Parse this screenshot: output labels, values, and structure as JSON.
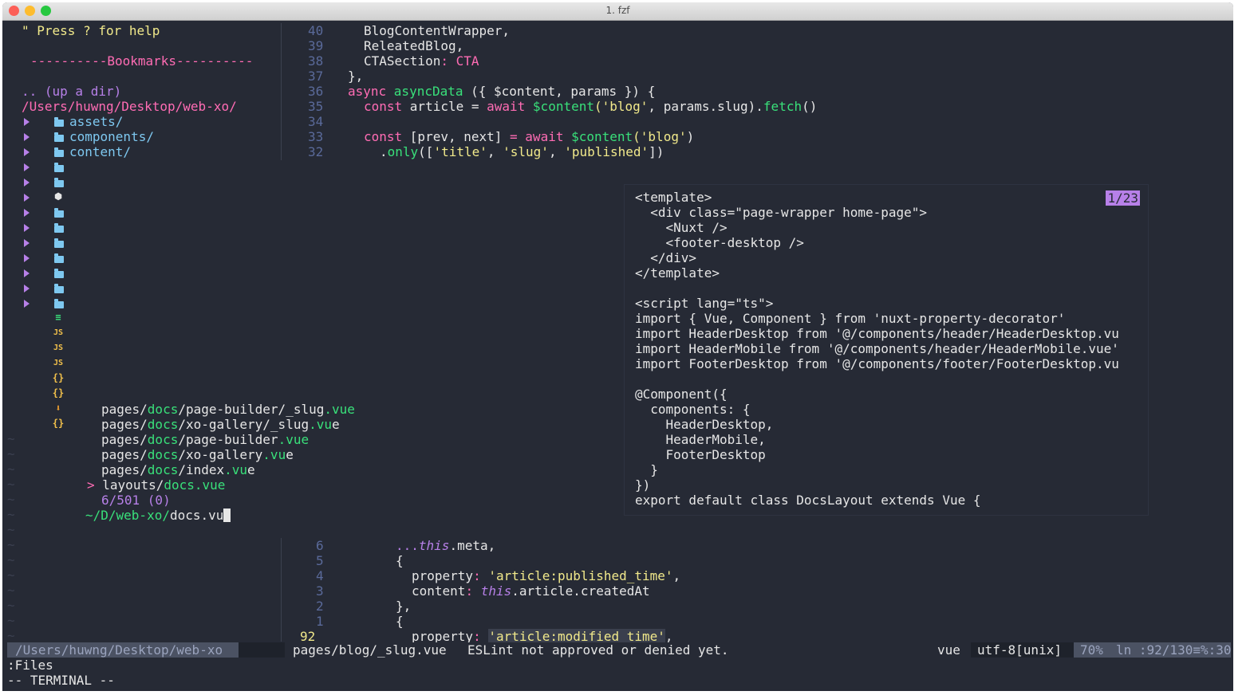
{
  "window": {
    "title": "1. fzf"
  },
  "colors": {
    "background": "#262a35",
    "pink": "#ff6cb4",
    "green": "#39e07a",
    "yellow": "#f1e98b",
    "purple": "#b780e8",
    "cyan": "#7ec8f0"
  },
  "nerdtree": {
    "help": "\" Press ? for help",
    "bookmarks": "----------Bookmarks----------",
    "up_dir": ".. (up a dir)",
    "root": "/Users/huwng/Desktop/web-xo/",
    "folders": [
      "assets/",
      "components/",
      "content/"
    ]
  },
  "editor_top": {
    "lines": [
      {
        "num": "40",
        "text": "BlogContentWrapper,"
      },
      {
        "num": "39",
        "text": "ReleatedBlog,"
      },
      {
        "num": "38",
        "text_key": "CTASection",
        "text_rest": ": CTA"
      },
      {
        "num": "37",
        "text": "},"
      },
      {
        "num": "36",
        "a": "async ",
        "b": "asyncData",
        "c": " ({ $content, params }) {"
      },
      {
        "num": "35",
        "a": "const ",
        "b": "article = ",
        "c": "await ",
        "d": "$content",
        "e": "('blog'",
        "f": ", params.slug).",
        "g": "fetch",
        "h": "()"
      },
      {
        "num": "34",
        "text": ""
      },
      {
        "num": "33",
        "a": "const ",
        "b": "[prev, next] ",
        "c": "= await ",
        "d": "$content",
        "e": "('blog'",
        "f": ")"
      },
      {
        "num": "32",
        "a": ".",
        "b": "only",
        "c": "([",
        "d": "'title'",
        "e": ", ",
        "f": "'slug'",
        "g": ", ",
        "h": "'published'",
        "i": "])"
      }
    ]
  },
  "fzf": {
    "results": [
      {
        "pre": "pages/",
        "dir": "docs",
        "mid": "/page-builder/_slug",
        "ext": ".vue",
        "last": ""
      },
      {
        "pre": "pages/",
        "dir": "docs",
        "mid": "/xo-gallery/_slug",
        "ext": ".vu",
        "last": "e"
      },
      {
        "pre": "pages/",
        "dir": "docs",
        "mid": "/page-builder",
        "ext": ".vue",
        "last": ""
      },
      {
        "pre": "pages/",
        "dir": "docs",
        "mid": "/xo-gallery",
        "ext": ".vu",
        "last": "e"
      },
      {
        "pre": "pages/",
        "dir": "docs",
        "mid": "/index",
        "ext": ".vu",
        "last": "e"
      }
    ],
    "selected": {
      "marker": ">",
      "pre": "layouts/",
      "dir": "docs",
      "ext": ".vue"
    },
    "count": "6/501 (0)",
    "prompt_path": "~/D/web-xo/",
    "query": "docs.vu"
  },
  "preview": {
    "badge": "1/23",
    "lines": [
      "<template>",
      "  <div class=\"page-wrapper home-page\">",
      "    <Nuxt />",
      "    <footer-desktop />",
      "  </div>",
      "</template>",
      "",
      "<script lang=\"ts\">",
      "import { Vue, Component } from 'nuxt-property-decorator'",
      "import HeaderDesktop from '@/components/header/HeaderDesktop.vu",
      "import HeaderMobile from '@/components/header/HeaderMobile.vue'",
      "import FooterDesktop from '@/components/footer/FooterDesktop.vu",
      "",
      "@Component({",
      "  components: {",
      "    HeaderDesktop,",
      "    HeaderMobile,",
      "    FooterDesktop",
      "  }",
      "})",
      "export default class DocsLayout extends Vue {"
    ]
  },
  "editor_bottom": {
    "lines": [
      {
        "num": "6",
        "a": "...",
        "b": "this",
        "c": ".meta,"
      },
      {
        "num": "5",
        "a": "{"
      },
      {
        "num": "4",
        "a": "property",
        "b": ": ",
        "c": "'article:published_time'",
        "d": ","
      },
      {
        "num": "3",
        "a": "content",
        "b": ": ",
        "c": "this",
        "d": ".article.createdAt"
      },
      {
        "num": "2",
        "a": "},"
      },
      {
        "num": "1",
        "a": "{"
      },
      {
        "num": "92",
        "a": "property",
        "b": ": ",
        "c": "'article:modified_time'",
        "d": ","
      }
    ]
  },
  "statusline": {
    "left_path": "/Users/huwng/Desktop/web-xo",
    "file": "pages/blog/_slug.vue",
    "message": "ESLint not approved or denied yet.",
    "filetype": "vue",
    "encoding": "utf-8[unix]",
    "percent": "70%",
    "position": "ln :92/130≡%:30"
  },
  "cmdline": {
    "line1": ":Files",
    "line2": "-- TERMINAL --"
  }
}
